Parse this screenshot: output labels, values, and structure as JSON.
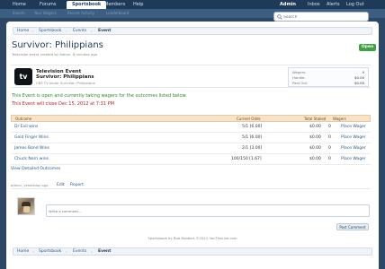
{
  "nav": {
    "tabs": [
      "Home",
      "Forums",
      "Sportsbook",
      "Members",
      "Help"
    ],
    "active_tab": "Sportsbook",
    "right": [
      "Admin",
      "Inbox",
      "Alerts",
      "Log Out"
    ]
  },
  "subnav": {
    "items": [
      "Events",
      "Your Wagers",
      "Recent Activity",
      "Leaderboard"
    ]
  },
  "search": {
    "placeholder": "Search"
  },
  "breadcrumb": [
    "Home",
    "Sportsbook",
    "Events",
    "Event"
  ],
  "page": {
    "title": "Survivor: Philippians",
    "subtitle": "Television event created by Admin, 8 minutes ago",
    "status_badge": "Open"
  },
  "event": {
    "type": "Television Event",
    "name": "Survivor: Philippians",
    "description": "CBS TV show: Survivor: Philippians",
    "logo": "tv",
    "stats": [
      {
        "label": "Wagers:",
        "value": "0"
      },
      {
        "label": "Handle:",
        "value": "$0.00"
      },
      {
        "label": "Paid Out:",
        "value": "$0.00"
      }
    ]
  },
  "messages": {
    "open": "This Event is open and currently taking wagers for the outcomes listed below.",
    "close": "This Event will close Dec 15, 2012 at 7:31 PM"
  },
  "outcomes_table": {
    "headers": [
      "Outcome",
      "Current Odds",
      "Total Staked",
      "Wagers"
    ],
    "rows": [
      {
        "outcome": "Dr Evil wins",
        "odds": "5/1 [6.00]",
        "staked": "$0.00",
        "wagers": "0",
        "action": "Place Wager"
      },
      {
        "outcome": "Gold Finger Wins",
        "odds": "5/1 [6.00]",
        "staked": "$0.00",
        "wagers": "0",
        "action": "Place Wager"
      },
      {
        "outcome": "James Bond Wins",
        "odds": "2/1 [3.00]",
        "staked": "$0.00",
        "wagers": "0",
        "action": "Place Wager"
      },
      {
        "outcome": "Chuck Norri wins",
        "odds": "100/150 [1.67]",
        "staked": "$0.00",
        "wagers": "0",
        "action": "Place Wager"
      }
    ],
    "view_detailed": "View Detailed Outcomes"
  },
  "meta": {
    "user": "admin, yesterday ago",
    "edit": "Edit",
    "report": "Report"
  },
  "comment": {
    "placeholder": "Write a comment...",
    "post_button": "Post Comment"
  },
  "footer": {
    "credit": "Sportsbook by Bob Bobbert ©2012 VanThaLive.com"
  },
  "colors": {
    "nav_bg": "#1f3a58",
    "accent_green": "#3fa33f",
    "open_text": "#2c8a2c",
    "close_text": "#c02020",
    "table_header": "#f6e3c9",
    "link": "#2a5a8a"
  }
}
